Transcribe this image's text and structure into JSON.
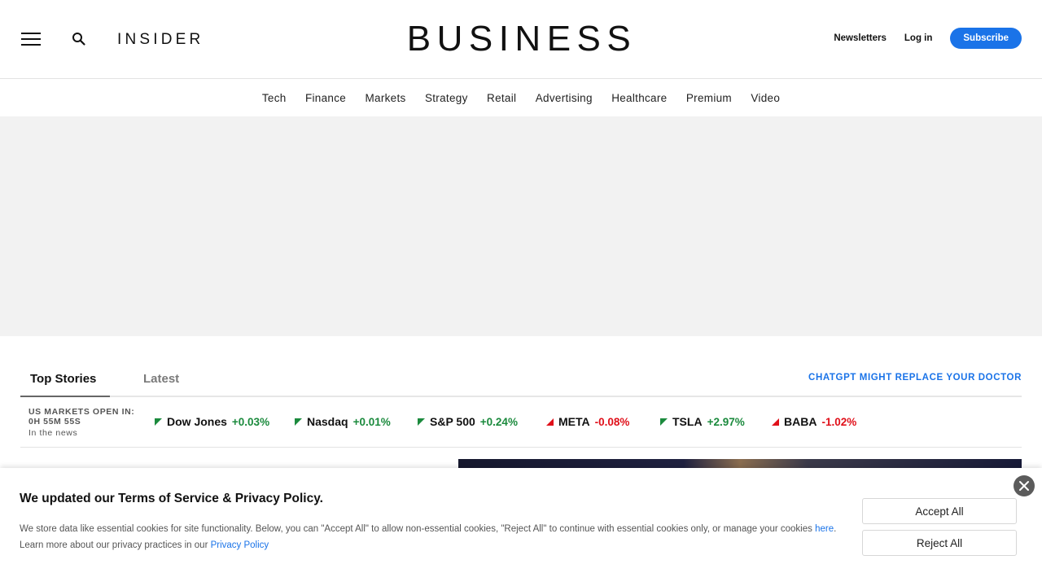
{
  "header": {
    "brand_small": "INSIDER",
    "brand_large": "BUSINESS",
    "newsletters_label": "Newsletters",
    "login_label": "Log in",
    "subscribe_label": "Subscribe"
  },
  "nav": {
    "items": [
      "Tech",
      "Finance",
      "Markets",
      "Strategy",
      "Retail",
      "Advertising",
      "Healthcare",
      "Premium",
      "Video"
    ]
  },
  "tabs": {
    "top_stories": "Top Stories",
    "latest": "Latest",
    "promo": "CHATGPT MIGHT REPLACE YOUR DOCTOR"
  },
  "ticker": {
    "market_label": "US MARKETS OPEN IN:",
    "countdown": "0H 55M 55S",
    "in_news": "In the news",
    "stocks": [
      {
        "name": "Dow Jones",
        "change": "+0.03%",
        "direction": "up"
      },
      {
        "name": "Nasdaq",
        "change": "+0.01%",
        "direction": "up"
      },
      {
        "name": "S&P 500",
        "change": "+0.24%",
        "direction": "up"
      },
      {
        "name": "META",
        "change": "-0.08%",
        "direction": "down"
      },
      {
        "name": "TSLA",
        "change": "+2.97%",
        "direction": "up"
      },
      {
        "name": "BABA",
        "change": "-1.02%",
        "direction": "down"
      }
    ]
  },
  "cookie": {
    "title": "We updated our Terms of Service & Privacy Policy.",
    "text_part1": "We store data like essential cookies for site functionality. Below, you can \"Accept All\" to allow non-essential cookies, \"Reject All\" to continue with essential cookies only, or manage your cookies ",
    "here_link": "here",
    "text_part2": ". Learn more about our privacy practices in our ",
    "privacy_link": "Privacy Policy",
    "accept_label": "Accept All",
    "reject_label": "Reject All"
  },
  "colors": {
    "accent": "#1a73e8",
    "positive": "#1b8a3d",
    "negative": "#e0101a"
  }
}
